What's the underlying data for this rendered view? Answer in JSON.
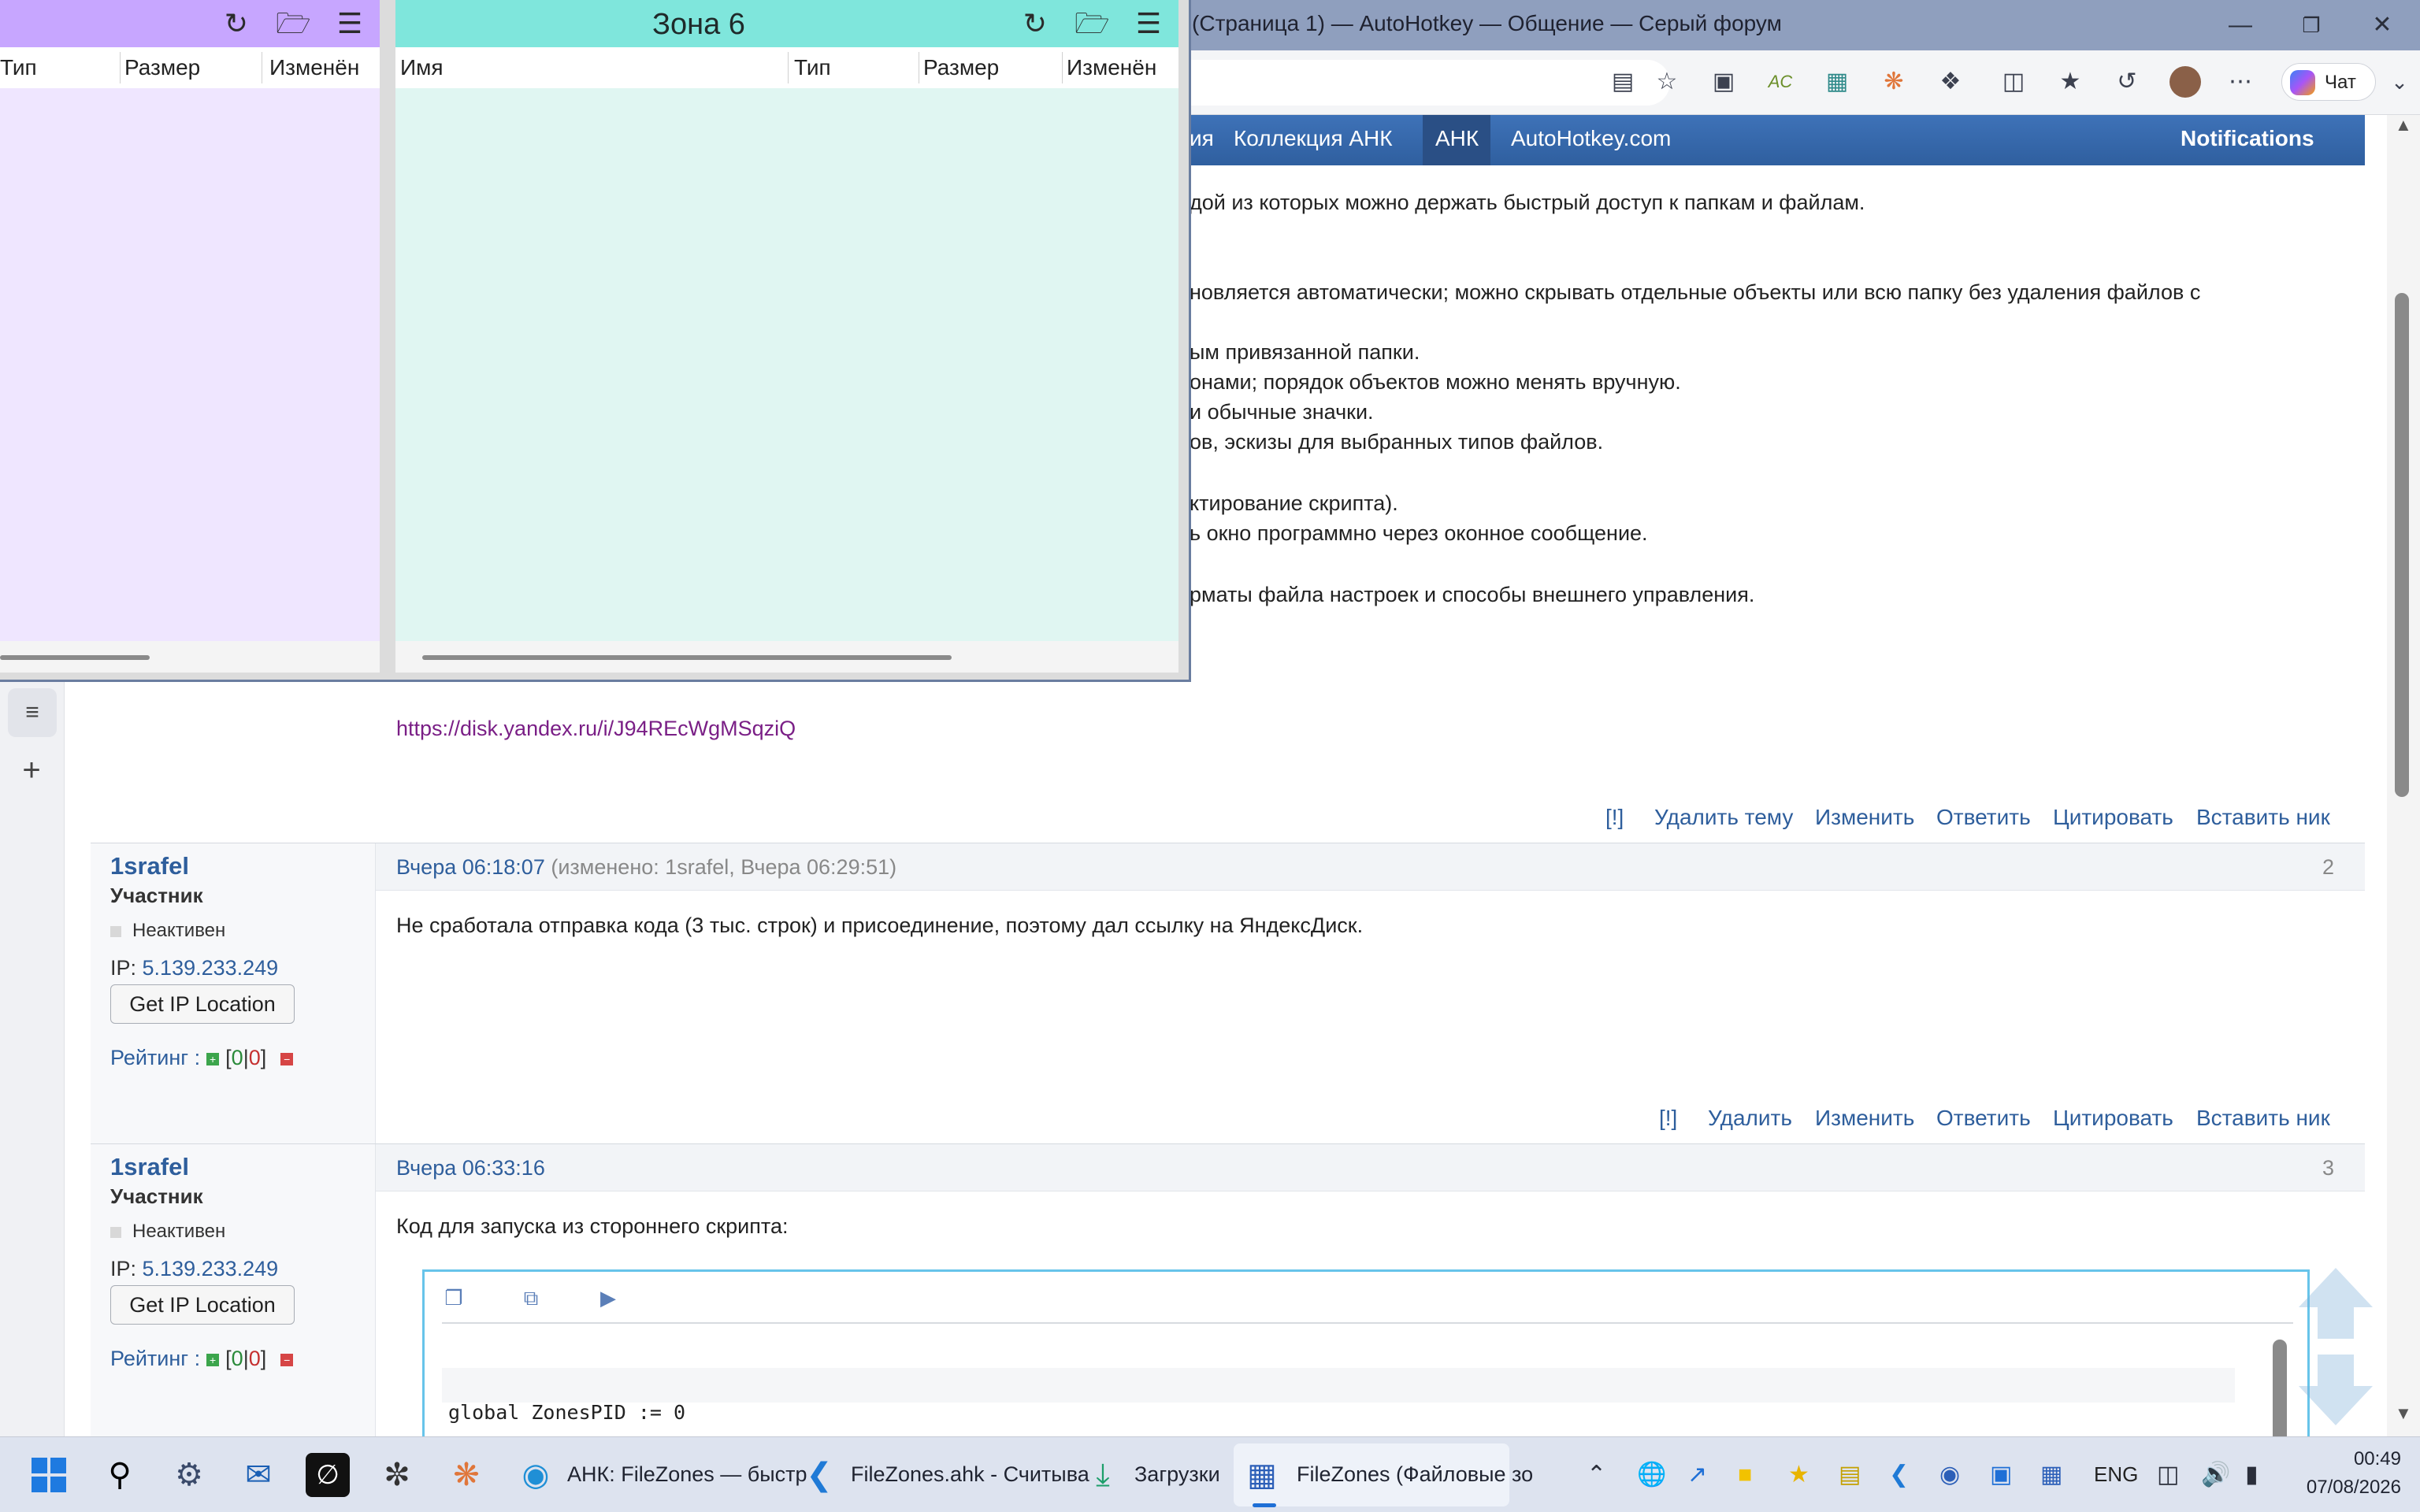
{
  "browser": {
    "window_title": "м (Страница 1) — AutoHotkey — Общение — Серый форум",
    "copilot_label": "Чат"
  },
  "forum_nav": {
    "items": [
      "ия",
      "Коллекция АНК",
      "АНК",
      "AutoHotkey.com"
    ],
    "notifications": "Notifications"
  },
  "post1": {
    "lines": [
      "дой из которых можно держать быстрый доступ к папкам и файлам.",
      "новляется автоматически; можно скрывать отдельные объекты или всю папку без удаления файлов с",
      "ым привязанной папки.",
      "онами; порядок объектов можно менять вручную.",
      "и обычные значки.",
      "ов, эскизы для выбранных типов файлов.",
      "ктирование скрипта).",
      "ь окно программно через оконное сообщение.",
      "рматы файла настроек и способы внешнего управления."
    ],
    "link": "https://disk.yandex.ru/i/J94REcWgMSqziQ",
    "actions": [
      "[!]",
      "Удалить тему",
      "Изменить",
      "Ответить",
      "Цитировать",
      "Вставить ник"
    ]
  },
  "post2": {
    "username": "1srafel",
    "role": "Участник",
    "status": "Неактивен",
    "ip_label": "IP:",
    "ip": "5.139.233.249",
    "get_ip_button": "Get IP Location",
    "rating_label": "Рейтинг :",
    "rating_pos": "0",
    "rating_neg": "0",
    "time": "Вчера 06:18:07",
    "edited": "(изменено: 1srafel, Вчера 06:29:51)",
    "number": "2",
    "text": "Не сработала отправка кода (3 тыс. строк) и присоединение, поэтому дал ссылку на ЯндексДиск.",
    "actions": [
      "[!]",
      "Удалить",
      "Изменить",
      "Ответить",
      "Цитировать",
      "Вставить ник"
    ]
  },
  "post3": {
    "username": "1srafel",
    "role": "Участник",
    "status": "Неактивен",
    "ip_label": "IP:",
    "ip": "5.139.233.249",
    "get_ip_button": "Get IP Location",
    "rating_label": "Рейтинг :",
    "rating_pos": "0",
    "rating_neg": "0",
    "time": "Вчера 06:33:16",
    "number": "3",
    "text": "Код для запуска из стороннего скрипта:",
    "code_line": "global ZonesPID := 0"
  },
  "filezones": {
    "left_zone": {
      "columns": [
        "Тип",
        "Размер",
        "Изменён"
      ],
      "color": "#c7a6ff"
    },
    "zone6": {
      "title": "Зона 6",
      "columns": [
        "Имя",
        "Тип",
        "Размер",
        "Изменён"
      ],
      "color": "#7fe6dc"
    }
  },
  "taskbar": {
    "apps": [
      {
        "label": "АНК: FileZones — быстр",
        "icon": "edge-icon"
      },
      {
        "label": "FileZones.ahk - Считыва",
        "icon": "vscode-icon"
      },
      {
        "label": "Загрузки",
        "icon": "downloads-icon"
      },
      {
        "label": "FileZones (Файловые зо",
        "icon": "filezones-icon"
      }
    ],
    "language": "ENG",
    "time": "00:49",
    "date": "07/08/2026"
  }
}
